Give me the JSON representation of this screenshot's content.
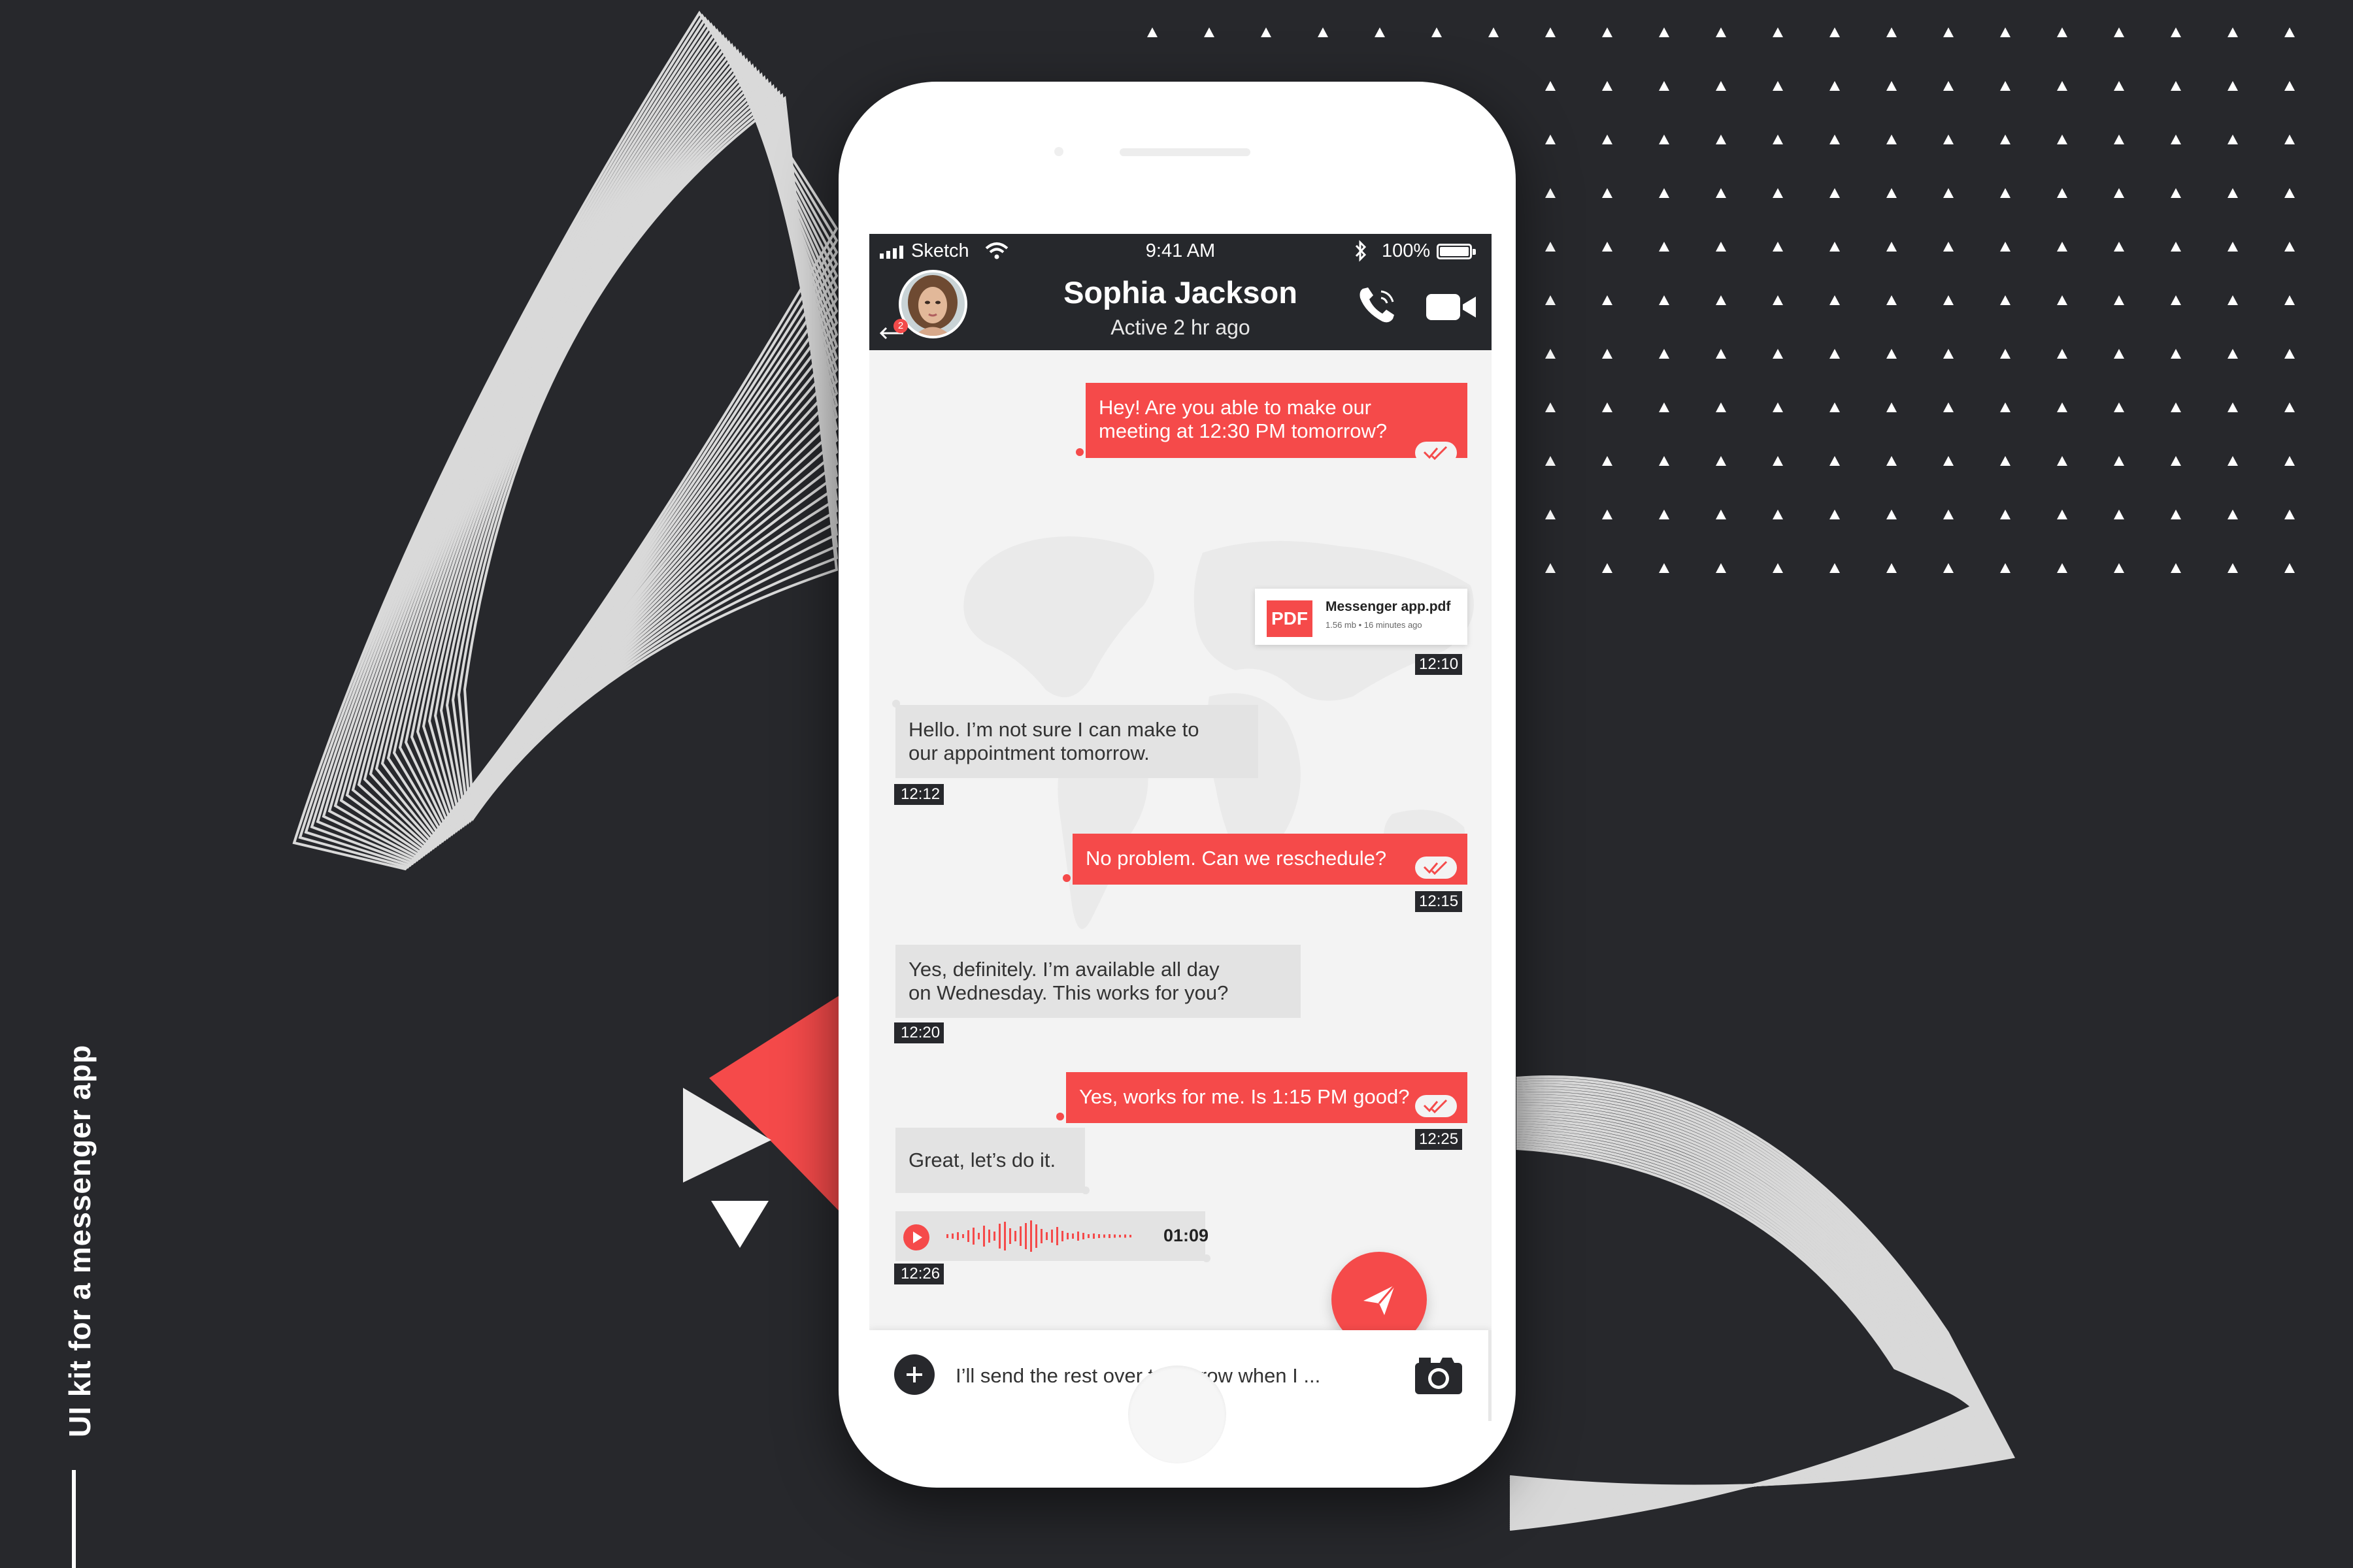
{
  "side_caption": "UI kit for a messenger app",
  "status_bar": {
    "carrier": "Sketch",
    "time": "9:41 AM",
    "battery": "100%"
  },
  "contact": {
    "name": "Sophia Jackson",
    "status": "Active 2 hr ago",
    "unread_badge": "2"
  },
  "messages": [
    {
      "direction": "outgoing",
      "lines": [
        "Hey! Are you able to make our",
        "meeting at 12:30 PM tomorrow?"
      ]
    },
    {
      "direction": "outgoing",
      "type": "file",
      "file_label": "PDF",
      "file_name": "Messenger app.pdf",
      "file_meta": "1.56 mb • 16 minutes ago",
      "time": "12:10"
    },
    {
      "direction": "incoming",
      "lines": [
        "Hello. I’m not sure I can make to",
        "our appointment tomorrow."
      ],
      "time": "12:12"
    },
    {
      "direction": "outgoing",
      "lines": [
        "No problem. Can we reschedule?"
      ],
      "time": "12:15"
    },
    {
      "direction": "incoming",
      "lines": [
        "Yes, definitely. I’m available all day",
        "on Wednesday. This works for you?"
      ],
      "time": "12:20"
    },
    {
      "direction": "outgoing",
      "lines": [
        "Yes, works for me. Is 1:15 PM good?"
      ],
      "time": "12:25"
    },
    {
      "direction": "incoming",
      "lines": [
        "Great, let’s do it."
      ]
    },
    {
      "direction": "incoming",
      "type": "voice",
      "duration": "01:09",
      "time": "12:26"
    }
  ],
  "composer": {
    "value": "I’ll send the rest over tomorrow when I ..."
  },
  "colors": {
    "accent": "#f54a4a",
    "dark": "#27282c",
    "incoming_bubble": "#e3e3e3"
  },
  "icons": [
    "signal-icon",
    "wifi-icon",
    "bluetooth-icon",
    "battery-icon",
    "back-arrow-icon",
    "phone-icon",
    "video-camera-icon",
    "read-check-icon",
    "play-icon",
    "send-icon",
    "plus-icon",
    "camera-icon"
  ]
}
